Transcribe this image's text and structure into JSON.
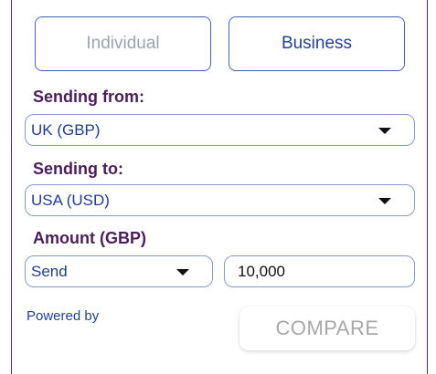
{
  "customer_type": {
    "options": [
      "Individual",
      "Business"
    ],
    "selected": "Business"
  },
  "sending_from": {
    "label": "Sending from:",
    "value": "UK (GBP)"
  },
  "sending_to": {
    "label": "Sending to:",
    "value": "USA (USD)"
  },
  "amount": {
    "label": "Amount (GBP)",
    "mode": "Send",
    "value": "10,000"
  },
  "footer": {
    "powered_by": "Powered by",
    "compare_label": "COMPARE"
  },
  "colors": {
    "label_purple": "#4b1e5a",
    "accent_blue": "#23409a",
    "border_blue": "#8b9bc7"
  }
}
